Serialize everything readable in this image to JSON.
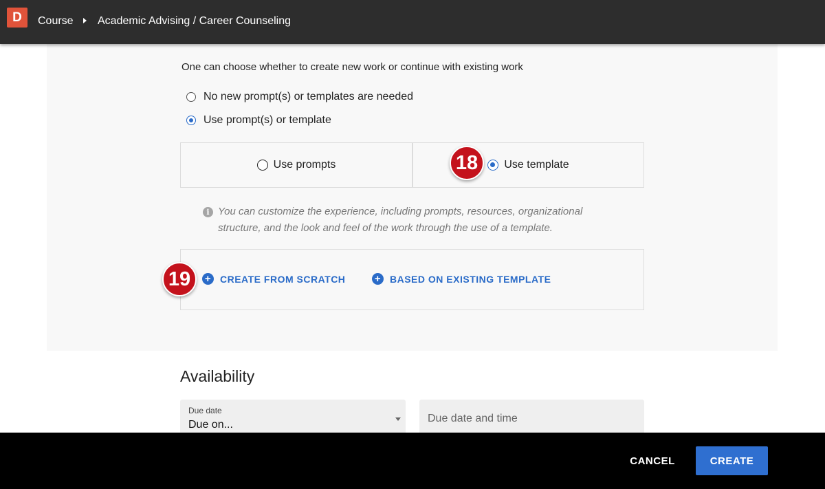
{
  "header": {
    "logo_letter": "D",
    "breadcrumb": {
      "course": "Course",
      "current": "Academic Advising / Career Counseling"
    }
  },
  "work_options": {
    "lead_text": "One can choose whether to create new work or continue with existing work",
    "radios": [
      {
        "label": "No new prompt(s) or templates are needed",
        "checked": false
      },
      {
        "label": "Use prompt(s) or template",
        "checked": true
      }
    ]
  },
  "mode_choice": {
    "use_prompts": {
      "label": "Use prompts",
      "checked": false
    },
    "use_template": {
      "label": "Use template",
      "checked": true
    }
  },
  "badges": {
    "step_18": "18",
    "step_19": "19"
  },
  "info": {
    "text": "You can customize the experience, including prompts, resources, organizational structure, and the look and feel of the work through the use of a template."
  },
  "template_actions": {
    "create_from_scratch": "CREATE FROM SCRATCH",
    "based_on_existing": "BASED ON EXISTING TEMPLATE"
  },
  "availability": {
    "heading": "Availability",
    "due_date": {
      "label": "Due date",
      "value": "Due on..."
    },
    "due_date_time": {
      "placeholder": "Due date and time"
    }
  },
  "footer": {
    "cancel_label": "CANCEL",
    "create_label": "CREATE"
  },
  "colors": {
    "accent": "#2a6bc8",
    "logo": "#e0533a",
    "badge": "#c4121c",
    "topbar": "#2d2d2d"
  }
}
